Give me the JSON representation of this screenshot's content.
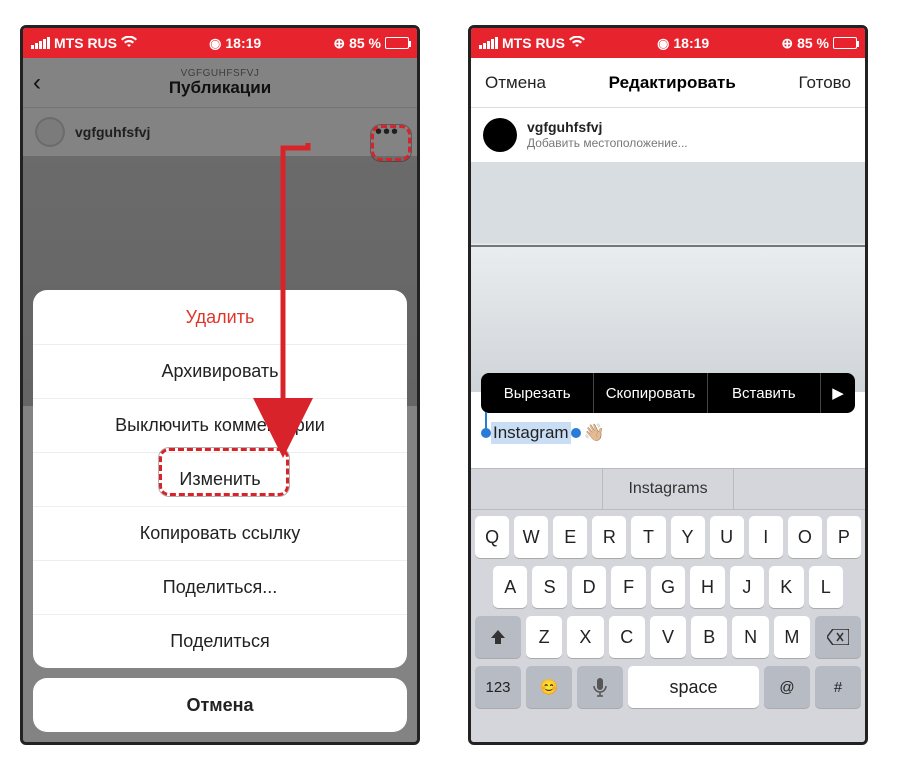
{
  "statusbar": {
    "carrier": "MTS RUS",
    "time": "18:19",
    "battery": "85 %"
  },
  "left": {
    "header_sub": "VGFGUHFSFVJ",
    "header_title": "Публикации",
    "username": "vgfguhfsfvj",
    "sheet": {
      "delete": "Удалить",
      "archive": "Архивировать",
      "comments_off": "Выключить комментарии",
      "edit": "Изменить",
      "copy_link": "Копировать ссылку",
      "share1": "Поделиться...",
      "share2": "Поделиться",
      "cancel": "Отмена"
    }
  },
  "right": {
    "nav_cancel": "Отмена",
    "nav_title": "Редактировать",
    "nav_done": "Готово",
    "username": "vgfguhfsfvj",
    "add_location": "Добавить местоположение...",
    "text_menu": {
      "cut": "Вырезать",
      "copy": "Скопировать",
      "paste": "Вставить"
    },
    "caption_text": "Instagram",
    "caption_emoji": "👋🏼",
    "suggestion_center": "Instagrams",
    "keyboard": {
      "row1": [
        "Q",
        "W",
        "E",
        "R",
        "T",
        "Y",
        "U",
        "I",
        "O",
        "P"
      ],
      "row2": [
        "A",
        "S",
        "D",
        "F",
        "G",
        "H",
        "J",
        "K",
        "L"
      ],
      "row3": [
        "Z",
        "X",
        "C",
        "V",
        "B",
        "N",
        "M"
      ],
      "num": "123",
      "space": "space",
      "hash": "#"
    }
  }
}
